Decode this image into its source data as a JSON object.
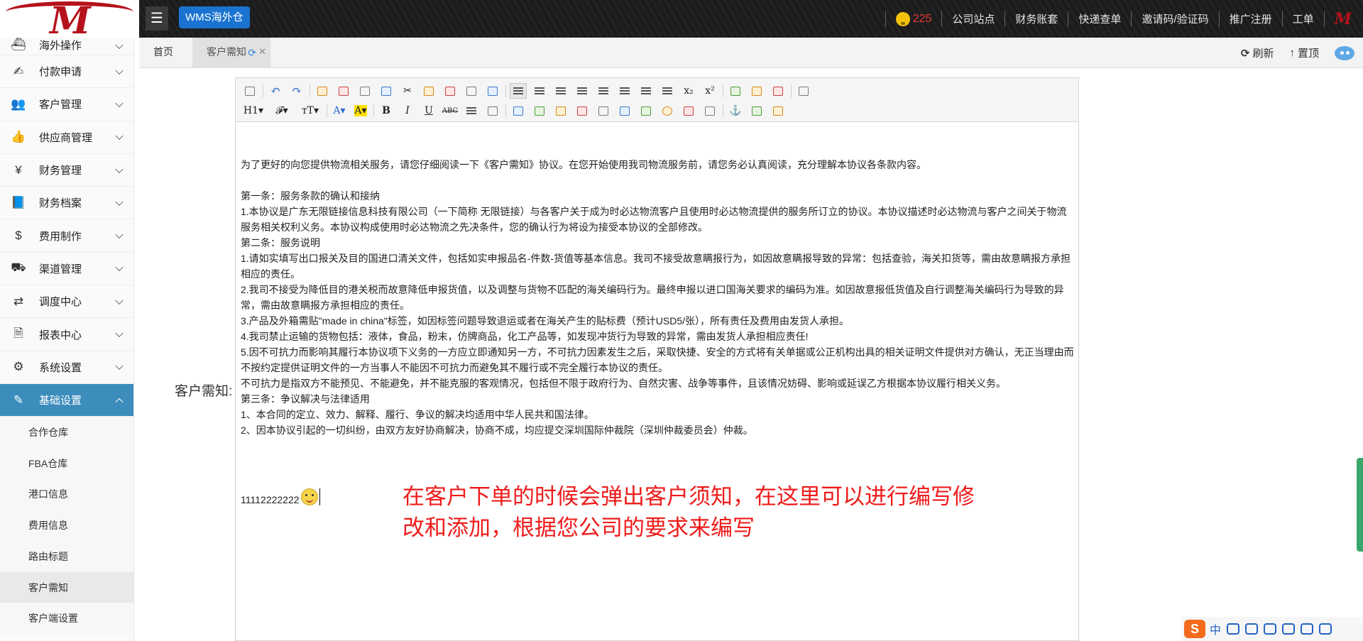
{
  "header": {
    "menu_icon": "hamburger-icon",
    "brand_label": "WMS海外仓",
    "notification_count": "225",
    "nav_links": [
      "公司站点",
      "财务账套",
      "快递查单",
      "邀请码/验证码",
      "推广注册",
      "工单"
    ],
    "user_logo": "M"
  },
  "sidebar": {
    "items": [
      {
        "icon": "ship-icon",
        "glyph": "⛴",
        "label": "海外操作"
      },
      {
        "icon": "payment-icon",
        "glyph": "✍",
        "label": "付款申请"
      },
      {
        "icon": "users-icon",
        "glyph": "👥",
        "label": "客户管理"
      },
      {
        "icon": "thumbs-up-icon",
        "glyph": "👍",
        "label": "供应商管理"
      },
      {
        "icon": "yen-icon",
        "glyph": "¥",
        "label": "财务管理"
      },
      {
        "icon": "book-icon",
        "glyph": "📘",
        "label": "财务档案"
      },
      {
        "icon": "dollar-icon",
        "glyph": "$",
        "label": "费用制作"
      },
      {
        "icon": "road-icon",
        "glyph": "⛟",
        "label": "渠道管理"
      },
      {
        "icon": "retweet-icon",
        "glyph": "⇄",
        "label": "调度中心"
      },
      {
        "icon": "report-icon",
        "glyph": "🗎",
        "label": "报表中心"
      },
      {
        "icon": "gear-icon",
        "glyph": "⚙",
        "label": "系统设置"
      },
      {
        "icon": "edit-icon",
        "glyph": "✎",
        "label": "基础设置"
      }
    ],
    "sub_items": [
      "合作仓库",
      "FBA仓库",
      "港口信息",
      "费用信息",
      "路由标题",
      "客户需知",
      "客户端设置"
    ]
  },
  "tabs": {
    "home": "首页",
    "current": "客户需知",
    "refresh_label": "刷新",
    "top_label": "置顶"
  },
  "form": {
    "label": "客户需知:"
  },
  "editor": {
    "row1": [
      "source-icon",
      "undo-icon",
      "redo-icon",
      "preview-icon",
      "print-icon",
      "template-icon",
      "code-icon",
      "cut-icon",
      "copy-icon",
      "paste-icon",
      "paste-text-icon",
      "paste-word-icon",
      "align-left-icon",
      "align-center-icon",
      "align-right-icon",
      "justify-icon",
      "ordered-list-icon",
      "unordered-list-icon",
      "indent-icon",
      "outdent-icon",
      "subscript-icon",
      "superscript-icon",
      "clear-format-icon",
      "select-all-icon",
      "cursor-icon",
      "fullscreen-icon"
    ],
    "row2": [
      "heading-icon",
      "font-family-icon",
      "font-size-icon",
      "font-color-icon",
      "highlight-icon",
      "bold-icon",
      "italic-icon",
      "underline-icon",
      "strikethrough-icon",
      "line-height-icon",
      "remove-format-icon",
      "image-icon",
      "multi-image-icon",
      "flash-icon",
      "media-icon",
      "attachment-icon",
      "table-icon",
      "insert-file-icon",
      "emoticon-icon",
      "baidu-map-icon",
      "page-break-icon",
      "anchor-icon",
      "link-icon",
      "unlink-icon"
    ],
    "glyphs": {
      "subscript-icon": "x₂",
      "superscript-icon": "x²",
      "heading-icon": "H1▾",
      "font-family-icon": "𝓕▾",
      "font-size-icon": "тT▾",
      "font-color-icon": "A▾",
      "highlight-icon": "A▾",
      "bold-icon": "B",
      "italic-icon": "I",
      "underline-icon": "U",
      "strikethrough-icon": "ABC",
      "anchor-icon": "⚓",
      "undo-icon": "↶",
      "redo-icon": "↷",
      "cut-icon": "✂"
    },
    "paragraphs": [
      "",
      "为了更好的向您提供物流相关服务，请您仔细阅读一下《客户需知》协议。在您开始使用我司物流服务前，请您务必认真阅读，充分理解本协议各条款内容。",
      "",
      "第一条：服务条款的确认和接纳",
      "1.本协议是广东无限链接信息科技有限公司（一下简称 无限链接）与各客户关于成为时必达物流客户且使用时必达物流提供的服务所订立的协议。本协议描述时必达物流与客户之间关于物流服务相关权利义务。本协议构成使用时必达物流之先决条件，您的确认行为将设为接受本协议的全部修改。",
      "第二条：服务说明",
      "1.请如实填写出口报关及目的国进口清关文件，包括如实申报品名-件数-货值等基本信息。我司不接受故意瞒报行为，如因故意瞒报导致的异常：包括查验，海关扣货等，需由故意瞒报方承担相应的责任。",
      "2.我司不接受为降低目的港关税而故意降低申报货值，以及调整与货物不匹配的海关编码行为。最终申报以进口国海关要求的编码为准。如因故意报低货值及自行调整海关编码行为导致的异常，需由故意瞒报方承担相应的责任。",
      "3.产品及外箱需贴\"made in china\"标签，如因标签问题导致退运或者在海关产生的贴标费（预计USD5/张），所有责任及费用由发货人承担。",
      "4.我司禁止运输的货物包括：液体，食品，粉末，仿牌商品，化工产品等，如发现冲货行为导致的异常，需由发货人承担相应责任!",
      "5.因不可抗力而影响其履行本协议项下义务的一方应立即通知另一方，不可抗力因素发生之后，采取快捷、安全的方式将有关单据或公正机构出具的相关证明文件提供对方确认，无正当理由而不按约定提供证明文件的一方当事人不能因不可抗力而避免其不履行或不完全履行本协议的责任。",
      "不可抗力是指双方不能预见、不能避免，并不能克服的客观情况，包括但不限于政府行为、自然灾害、战争等事件，且该情况妨碍、影响或延误乙方根据本协议履行相关义务。",
      "第三条：争议解决与法律适用",
      "1、本合同的定立、效力、解释、履行、争议的解决均适用中华人民共和国法律。",
      "2、因本协议引起的一切纠纷，由双方友好协商解决，协商不成，均应提交深圳国际仲裁院（深圳仲裁委员会）仲裁。"
    ],
    "signature": "11112222222"
  },
  "annotation": "在客户下单的时候会弹出客户须知，在这里可以进行编写修改和添加，根据您公司的要求来编写",
  "ime": {
    "logo": "S",
    "lang": "中"
  },
  "colors": {
    "brand_button": "#1a73d1",
    "sidebar_active": "#3c8dbc",
    "annotation": "#ef1b1b",
    "notification": "#e53935"
  }
}
